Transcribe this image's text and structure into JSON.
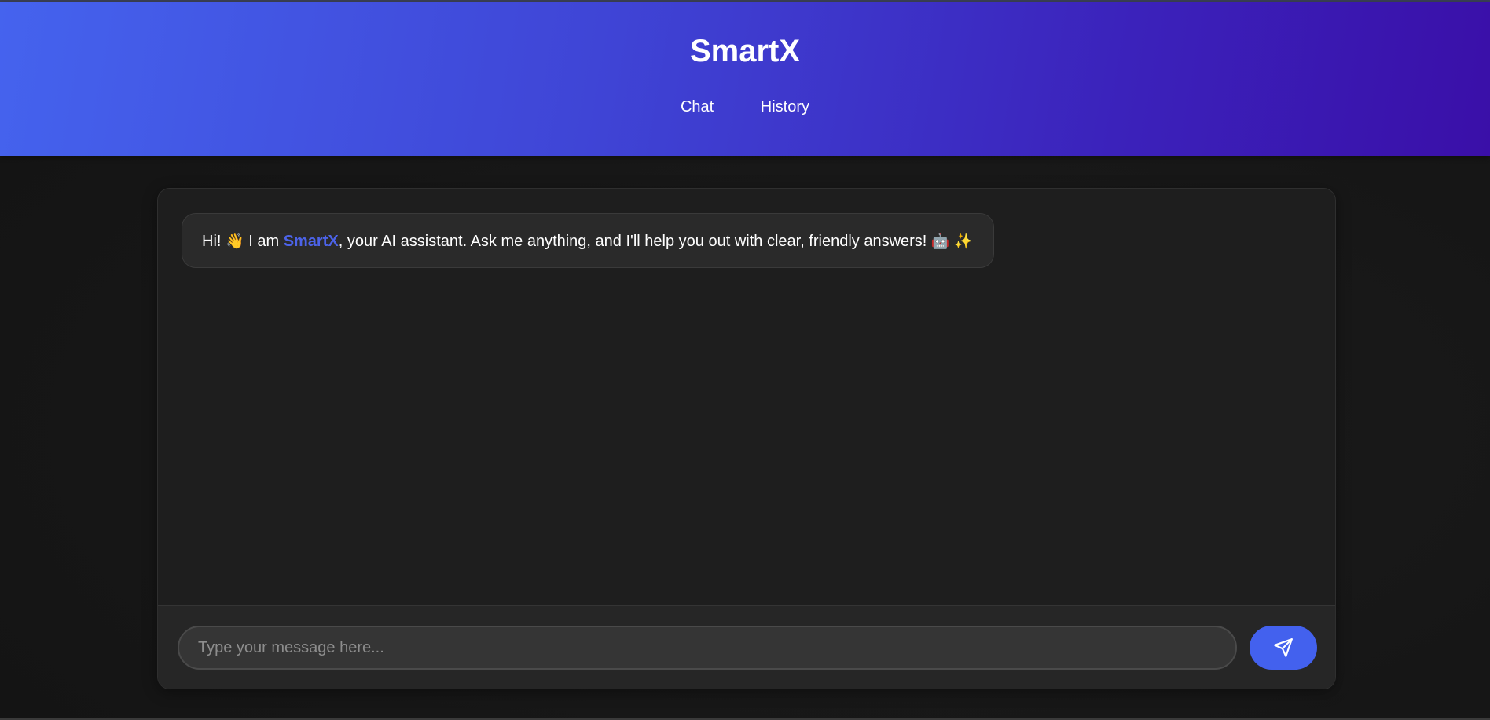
{
  "app": {
    "title": "SmartX"
  },
  "nav": {
    "items": [
      {
        "label": "Chat"
      },
      {
        "label": "History"
      }
    ]
  },
  "chat": {
    "messages": [
      {
        "role": "assistant",
        "prefix": "Hi! ",
        "wave_emoji": "👋",
        "intro": " I am ",
        "brand": "SmartX",
        "body": ", your AI assistant. Ask me anything, and I'll help you out with clear, friendly answers! ",
        "robot_emoji": "🤖",
        "sparkle_emoji": "✨"
      }
    ]
  },
  "composer": {
    "placeholder": "Type your message here...",
    "value": "",
    "send_icon": "send-icon"
  },
  "colors": {
    "accent": "#4361ee",
    "brand_text": "#4c63e8",
    "header_gradient_start": "#4563ee",
    "header_gradient_end": "#3a0fa8",
    "background": "#141414",
    "card": "#1e1e1e",
    "bubble": "#2a2a2a"
  }
}
